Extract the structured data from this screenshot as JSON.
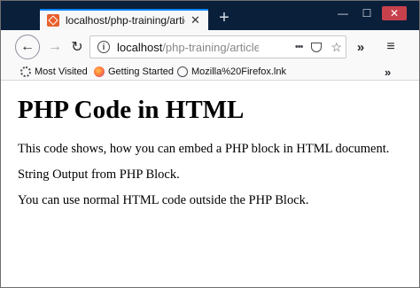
{
  "tab": {
    "title": "localhost/php-training/article-",
    "close_glyph": "✕"
  },
  "window_controls": {
    "minimize": "—",
    "maximize": "☐",
    "close": "✕"
  },
  "navbar": {
    "url_host": "localhost",
    "url_path": "/php-training/article-c",
    "more_actions": "•••",
    "overflow": "»",
    "menu": "≡"
  },
  "bookmarks": [
    {
      "label": "Most Visited",
      "icon": "gear-icon"
    },
    {
      "label": "Getting Started",
      "icon": "firefox-icon"
    },
    {
      "label": "Mozilla%20Firefox.lnk",
      "icon": "globe-icon"
    }
  ],
  "bookmarks_overflow": "»",
  "page": {
    "heading": "PHP Code in HTML",
    "paragraphs": [
      "This code shows, how you can embed a PHP block in HTML document.",
      "String Output from PHP Block.",
      "You can use normal HTML code outside the PHP Block."
    ]
  },
  "colors": {
    "titlebar": "#0a1f3a",
    "tab_accent": "#0a84ff",
    "toolbar": "#f9f9fa",
    "close_button": "#c7414d"
  }
}
